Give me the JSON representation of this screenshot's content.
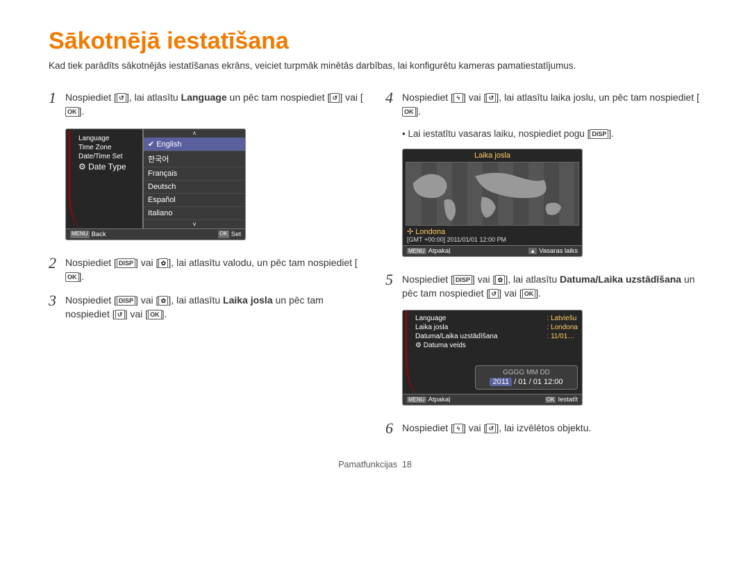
{
  "title": "Sākotnējā iestatīšana",
  "intro": "Kad tiek parādīts sākotnējās iestatīšanas ekrāns, veiciet turpmāk minētās darbības, lai konfigurētu kameras pamatiestatījumus.",
  "icons": {
    "timer": "t",
    "ok": "OK",
    "disp": "DISP",
    "flower": "M",
    "bolt": "F",
    "menu": "MENU",
    "up": "▲"
  },
  "steps": {
    "s1": {
      "pre": "Nospiediet [",
      "mid1": "], lai atlasītu ",
      "bold": "Language",
      "mid2": " un pēc tam nospiediet [",
      "mid3": "] vai [",
      "end": "]."
    },
    "s2": {
      "pre": "Nospiediet [",
      "vai": "] vai [",
      "mid": "], lai atlasītu valodu, un pēc tam nospiediet [",
      "end": "]."
    },
    "s3": {
      "pre": "Nospiediet [",
      "vai": "] vai [",
      "mid": "], lai atlasītu ",
      "bold": "Laika josla",
      "post": " un pēc tam nospiediet [",
      "vai2": "] vai [",
      "end": "]."
    },
    "s4": {
      "pre": "Nospiediet [",
      "vai": "] vai [",
      "mid": "], lai atlasītu laika joslu, un pēc tam nospiediet [",
      "end": "]."
    },
    "s4note": "Lai iestatītu vasaras laiku, nospiediet pogu [",
    "s4note_end": "].",
    "s5": {
      "pre": "Nospiediet [",
      "vai": "] vai [",
      "mid": "], lai atlasītu ",
      "bold": "Datuma/Laika uzstādīšana",
      "post": " un pēc tam nospiediet [",
      "vai2": "] vai [",
      "end": "]."
    },
    "s6": {
      "pre": "Nospiediet [",
      "vai": "] vai [",
      "end": "], lai izvēlētos objektu."
    }
  },
  "lcd1": {
    "menu_left": [
      "Language",
      "Time Zone",
      "Date/Time Set",
      "Date Type"
    ],
    "options": [
      "English",
      "한국어",
      "Français",
      "Deutsch",
      "Español",
      "Italiano"
    ],
    "bar_left_btn": "MENU",
    "bar_left": "Back",
    "bar_right_btn": "OK",
    "bar_right": "Set"
  },
  "lcd2": {
    "title": "Laika josla",
    "city": "Londona",
    "gmt": "[GMT +00:00] 2011/01/01 12:00 PM",
    "bar_left_btn": "MENU",
    "bar_left": "Atpakaļ",
    "bar_right_btn": "▲",
    "bar_right": "Vasaras laiks"
  },
  "lcd3": {
    "rows": [
      {
        "label": "Language",
        "val": "Latviešu"
      },
      {
        "label": "Laika josla",
        "val": "Londona"
      },
      {
        "label": "Datuma/Laika uzstādīšana",
        "val": "11/01…"
      },
      {
        "label": "Datuma veids",
        "val": ""
      }
    ],
    "date_hdr": "GGGG MM DD",
    "date_val_sel": "2011",
    "date_val_rest": " / 01 / 01 12:00",
    "bar_left_btn": "MENU",
    "bar_left": "Atpakaļ",
    "bar_right_btn": "OK",
    "bar_right": "Iestatīt"
  },
  "footer": {
    "label": "Pamatfunkcijas",
    "page": "18"
  }
}
